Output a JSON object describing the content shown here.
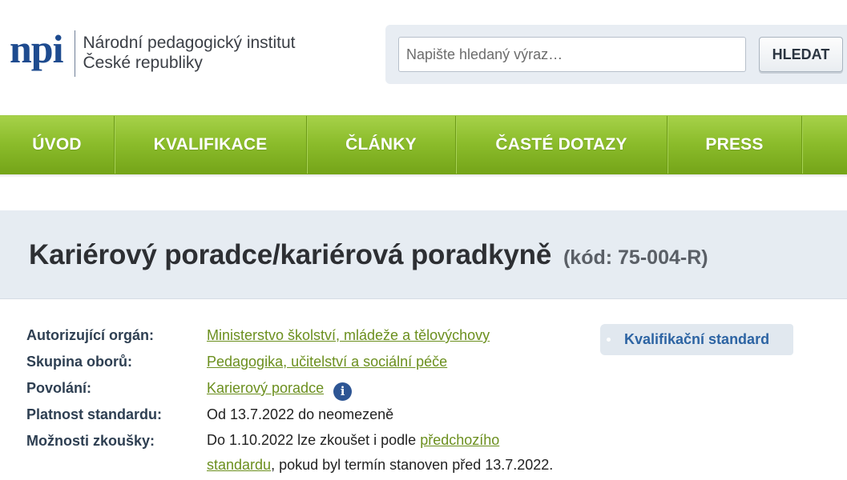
{
  "header": {
    "logo_mark": "npi",
    "org_name_line1": "Národní pedagogický institut",
    "org_name_line2": "České republiky",
    "search": {
      "placeholder": "Napište hledaný výraz…",
      "value": "",
      "button_label": "HLEDAT"
    }
  },
  "nav": {
    "items": [
      {
        "label": "ÚVOD"
      },
      {
        "label": "KVALIFIKACE"
      },
      {
        "label": "ČLÁNKY"
      },
      {
        "label": "ČASTÉ DOTAZY"
      },
      {
        "label": "PRESS"
      }
    ]
  },
  "page": {
    "title": "Kariérový poradce/kariérová poradkyně",
    "code": "(kód: 75-004-R)"
  },
  "details": {
    "authority": {
      "label": "Autorizující orgán:",
      "value": "Ministerstvo školství, mládeže a tělovýchovy"
    },
    "field_group": {
      "label": "Skupina oborů:",
      "value": "Pedagogika, učitelství a sociální péče"
    },
    "profession": {
      "label": "Povolání:",
      "value": "Karierový poradce",
      "info_icon": "info-icon"
    },
    "validity": {
      "label": "Platnost standardu:",
      "value": "Od 13.7.2022 do neomezeně"
    },
    "exam_options": {
      "label": "Možnosti zkoušky:",
      "text_before": "Do 1.10.2022 lze zkoušet i podle ",
      "link_part1": "předchozího",
      "link_part2": "standardu",
      "text_after": ", pokud byl termín stanoven před 13.7.2022."
    }
  },
  "side": {
    "qualification_standard_label": "Kvalifikační standard"
  },
  "colors": {
    "nav_green": "#8cbd2c",
    "link_green": "#6b8f1e",
    "brand_blue": "#1e4b8f",
    "title_band": "#e6ecf2"
  }
}
